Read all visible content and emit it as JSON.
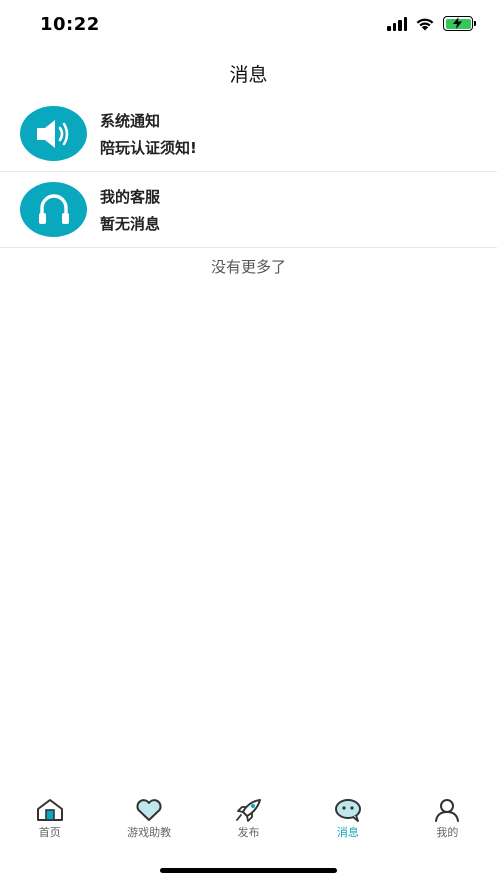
{
  "status_bar": {
    "time": "10:22",
    "icons": [
      "signal-icon",
      "wifi-icon",
      "battery-charging-icon"
    ]
  },
  "header": {
    "title": "消息"
  },
  "messages": [
    {
      "icon": "speaker-icon",
      "title": "系统通知",
      "subtitle": "陪玩认证须知!"
    },
    {
      "icon": "headset-icon",
      "title": "我的客服",
      "subtitle": "暂无消息"
    }
  ],
  "list_footer": "没有更多了",
  "tab_bar": {
    "active": "消息",
    "items": [
      {
        "label": "首页",
        "icon": "home-icon"
      },
      {
        "label": "游戏助教",
        "icon": "heart-icon"
      },
      {
        "label": "发布",
        "icon": "rocket-icon"
      },
      {
        "label": "消息",
        "icon": "chat-bubble-icon"
      },
      {
        "label": "我的",
        "icon": "person-icon"
      }
    ]
  },
  "colors": {
    "accent": "#0aa8bf",
    "battery": "#34c759",
    "divider": "#e8e8e8"
  }
}
